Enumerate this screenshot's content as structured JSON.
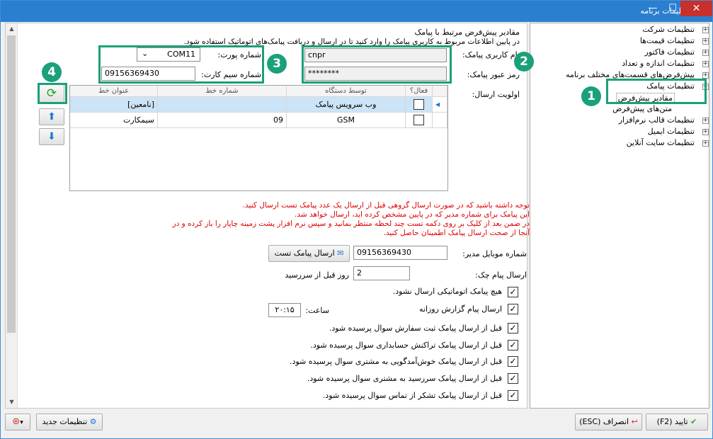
{
  "window": {
    "title": "تنظیمات برنامه",
    "min": "—",
    "max": "☐",
    "close": "✕"
  },
  "tree": [
    {
      "label": "تنظیمات شرکت",
      "exp": "+"
    },
    {
      "label": "تنظیمات قیمت‌ها",
      "exp": "+"
    },
    {
      "label": "تنظیمات فاکتور",
      "exp": "+"
    },
    {
      "label": "تنظیمات اندازه و تعداد",
      "exp": "+"
    },
    {
      "label": "پیش‌فرض‌های قسمت‌های مختلف برنامه",
      "exp": "+"
    },
    {
      "label": "تنظیمات پیامک",
      "exp": "−"
    },
    {
      "label": "مقادیر پیش‌فرض",
      "exp": ""
    },
    {
      "label": "متن‌های پیش‌فرض",
      "exp": ""
    },
    {
      "label": "تنظیمات قالب نرم‌افزار",
      "exp": "+"
    },
    {
      "label": "تنظیمات ایمیل",
      "exp": "+"
    },
    {
      "label": "تنظیمات سایت آنلاین",
      "exp": "+"
    }
  ],
  "section": {
    "title": "مقادیر پیش‌فرض مرتبط با پیامک",
    "desc": "در پایین اطلاعات مربوط به کاربری پیامک را وارد کنید تا در ارسال و دریافت پیامک‌های اتوماتیک استفاده شود."
  },
  "sms_user_label": "نام کاربری پیامک:",
  "sms_user_value": "cnpr",
  "sms_pass_label": "رمز عبور پیامک:",
  "sms_pass_value": "********",
  "port_label": "شماره پورت:",
  "port_value": "COM11",
  "sim_label": "شماره سیم کارت:",
  "sim_value": "09156369430",
  "priority_label": "اولویت ارسال:",
  "grid": {
    "headers": {
      "active": "فعال؟",
      "by_device": "توسط دستگاه",
      "line_no": "شماره خط",
      "line_title": "عنوان خط"
    },
    "rows": [
      {
        "device": "وب سرویس پیامک",
        "line_no": "",
        "title": "[نامعین]"
      },
      {
        "device": "GSM",
        "line_no": "09",
        "title": "سیمکارت"
      }
    ]
  },
  "notes": [
    "توجه داشته باشید که در صورت ارسال گروهی قبل از ارسال یک عدد پیامک تست ارسال کنید.",
    "این پیامک برای شماره مدیر که در پایین مشخص کرده اید، ارسال خواهد شد.",
    "در ضمن بعد از کلیک بر روی دکمه تست چند لحظه منتظر بمانید و سپس نرم افزار پشت زمینه چاپار را باز کرده و در",
    "آنجا از صحت ارسال پیامک اطمینان حاصل کنید."
  ],
  "manager_label": "شماره موبایل مدیر:",
  "manager_value": "09156369430",
  "send_test_label": "ارسال پیامک تست",
  "check_label": "ارسال پیام چک:",
  "check_value": "2",
  "check_suffix": "روز قبل از سررسید",
  "time_label": "ساعت:",
  "time_value": "۲۰:۱۵",
  "checks": [
    "هیچ پیامک اتوماتیکی ارسال نشود.",
    "ارسال پیام گزارش روزانه",
    "قبل از ارسال پیامک ثبت سفارش سوال پرسیده شود.",
    "قبل از ارسال پیامک تراکنش حسابداری سوال پرسیده شود.",
    "قبل از ارسال پیامک خوش‌آمدگویی به مشتری سوال پرسیده شود.",
    "قبل از ارسال پیامک سررسید به مشتری سوال پرسیده شود.",
    "قبل از ارسال پیامک تشکر از تماس سوال پرسیده شود."
  ],
  "badges": [
    "1",
    "2",
    "3",
    "4"
  ],
  "footer": {
    "new_settings": "تنظیمات جدید",
    "cancel": "انصراف (ESC)",
    "ok": "تایید (F2)"
  }
}
